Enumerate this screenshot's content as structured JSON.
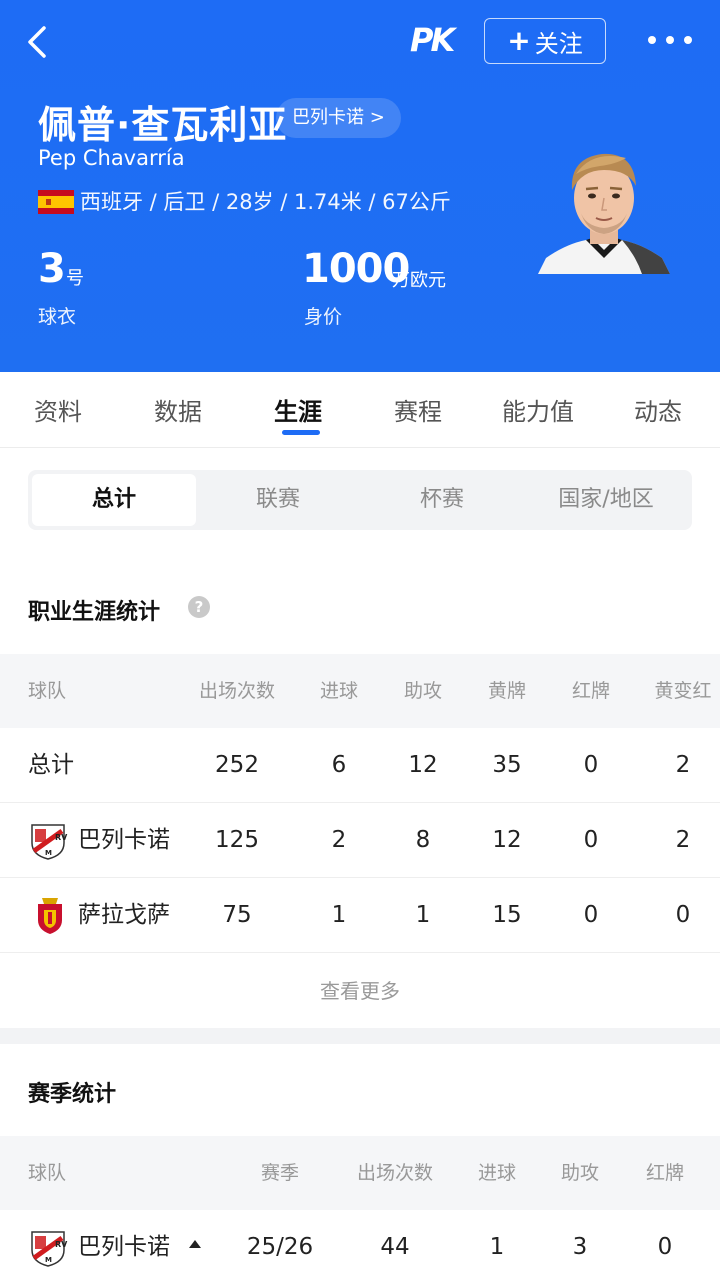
{
  "header": {
    "follow_label": "关注",
    "player_name": "佩普·查瓦利亚",
    "club_tag": "巴列卡诺 >",
    "player_en": "Pep Chavarría",
    "bio": "西班牙 / 后卫 / 28岁 / 1.74米 / 67公斤",
    "shirt_number": "3",
    "shirt_unit": "号",
    "shirt_label": "球衣",
    "market_value": "1000",
    "market_value_unit": "万欧元",
    "market_value_label": "身价",
    "brand_color": "#1e6cf5"
  },
  "tabs": [
    "资料",
    "数据",
    "生涯",
    "赛程",
    "能力值",
    "动态"
  ],
  "active_tab": "生涯",
  "segments": [
    "总计",
    "联赛",
    "杯赛",
    "国家/地区"
  ],
  "active_segment": "总计",
  "career": {
    "title": "职业生涯统计",
    "columns": [
      "球队",
      "出场次数",
      "进球",
      "助攻",
      "黄牌",
      "红牌",
      "黄变红"
    ],
    "rows": [
      {
        "team": "总计",
        "apps": "252",
        "goals": "6",
        "assists": "12",
        "yellow": "35",
        "red": "0",
        "second_yellow": "2"
      },
      {
        "team": "巴列卡诺",
        "apps": "125",
        "goals": "2",
        "assists": "8",
        "yellow": "12",
        "red": "0",
        "second_yellow": "2"
      },
      {
        "team": "萨拉戈萨",
        "apps": "75",
        "goals": "1",
        "assists": "1",
        "yellow": "15",
        "red": "0",
        "second_yellow": "0"
      }
    ],
    "more_label": "查看更多"
  },
  "season": {
    "title": "赛季统计",
    "columns": [
      "球队",
      "赛季",
      "出场次数",
      "进球",
      "助攻",
      "红牌"
    ],
    "rows": [
      {
        "team": "巴列卡诺",
        "season": "25/26",
        "apps": "44",
        "goals": "1",
        "assists": "3",
        "red": "0"
      }
    ]
  },
  "icons": {
    "back": "back-arrow-icon",
    "logo": "app-logo",
    "more": "more-dots-icon",
    "help": "help-icon",
    "flag": "spain-flag-icon",
    "caret": "caret-up-icon"
  }
}
